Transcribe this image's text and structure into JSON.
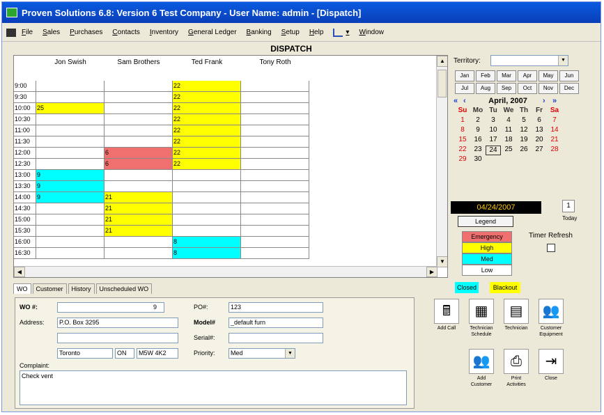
{
  "window": {
    "title": "Proven Solutions 6.8: Version 6 Test Company - User Name: admin - [Dispatch]"
  },
  "menu": [
    "File",
    "Sales",
    "Purchases",
    "Contacts",
    "Inventory",
    "General Ledger",
    "Banking",
    "Setup",
    "Help",
    "Window"
  ],
  "dispatch": {
    "title": "DISPATCH",
    "technicians": [
      "Jon Swish",
      "Sam Brothers",
      "Ted Frank",
      "Tony Roth"
    ],
    "times": [
      "9:00",
      "9:30",
      "10:00",
      "10:30",
      "11:00",
      "11:30",
      "12:00",
      "12:30",
      "13:00",
      "13:30",
      "14:00",
      "14:30",
      "15:00",
      "15:30",
      "16:00",
      "16:30"
    ],
    "cells": {
      "jon": [
        "",
        "",
        "25",
        "",
        "",
        "",
        "",
        "",
        "9",
        "9",
        "9",
        "",
        "",
        "",
        "",
        ""
      ],
      "sam": [
        "",
        "",
        "",
        "",
        "",
        "",
        "6",
        "6",
        "",
        "",
        "21",
        "21",
        "21",
        "21",
        "",
        ""
      ],
      "ted": [
        "22",
        "22",
        "22",
        "22",
        "22",
        "22",
        "22",
        "22",
        "",
        "",
        "",
        "",
        "",
        "",
        "8",
        "8"
      ]
    },
    "cell_colors": {
      "jon": [
        "",
        "",
        "#ffff00",
        "",
        "",
        "",
        "",
        "",
        "#00ffff",
        "#00ffff",
        "#00ffff",
        "",
        "",
        "",
        "",
        ""
      ],
      "sam": [
        "",
        "",
        "",
        "",
        "",
        "",
        "#f07070",
        "#f07070",
        "",
        "",
        "#ffff00",
        "#ffff00",
        "#ffff00",
        "#ffff00",
        "",
        ""
      ],
      "ted": [
        "#ffff00",
        "#ffff00",
        "#ffff00",
        "#ffff00",
        "#ffff00",
        "#ffff00",
        "#ffff00",
        "#ffff00",
        "",
        "",
        "",
        "",
        "",
        "",
        "#00ffff",
        "#00ffff"
      ]
    }
  },
  "territory": {
    "label": "Territory:"
  },
  "months": [
    "Jan",
    "Feb",
    "Mar",
    "Apr",
    "May",
    "Jun",
    "Jul",
    "Aug",
    "Sep",
    "Oct",
    "Nov",
    "Dec"
  ],
  "calendar": {
    "month_label": "April, 2007",
    "weekdays": [
      "Su",
      "Mo",
      "Tu",
      "We",
      "Th",
      "Fr",
      "Sa"
    ],
    "days": [
      "1",
      "2",
      "3",
      "4",
      "5",
      "6",
      "7",
      "8",
      "9",
      "10",
      "11",
      "12",
      "13",
      "14",
      "15",
      "16",
      "17",
      "18",
      "19",
      "20",
      "21",
      "22",
      "23",
      "24",
      "25",
      "26",
      "27",
      "28",
      "29",
      "30"
    ],
    "selected_date": "04/24/2007",
    "today_label": "Today"
  },
  "legend": {
    "button": "Legend",
    "items": [
      {
        "label": "Emergency",
        "color": "#f07070"
      },
      {
        "label": "High",
        "color": "#ffff00"
      },
      {
        "label": "Med",
        "color": "#00ffff"
      },
      {
        "label": "Low",
        "color": "#ffffff"
      }
    ],
    "closed": "Closed",
    "blackout": "Blackout"
  },
  "timer_refresh": "Timer Refresh",
  "tabs": [
    "WO",
    "Customer",
    "History",
    "Unscheduled WO"
  ],
  "wo": {
    "wo_label": "WO #:",
    "wo_value": "9",
    "address_label": "Address:",
    "address1": "P.O. Box 3295",
    "address2": "",
    "city": "Toronto",
    "prov": "ON",
    "postal": "M5W 4K2",
    "complaint_label": "Complaint:",
    "complaint": "Check vent",
    "po_label": "PO#:",
    "po_value": "123",
    "model_label": "Model#",
    "model_value": "_default furn",
    "serial_label": "Serial#:",
    "serial_value": "",
    "priority_label": "Priority:",
    "priority_value": "Med"
  },
  "actions": [
    {
      "label": "Add Call"
    },
    {
      "label": "Technician Schedule"
    },
    {
      "label": "Technician"
    },
    {
      "label": "Customer Equipment"
    },
    {
      "label": "Add Customer"
    },
    {
      "label": "Print Activities"
    },
    {
      "label": "Close"
    }
  ]
}
